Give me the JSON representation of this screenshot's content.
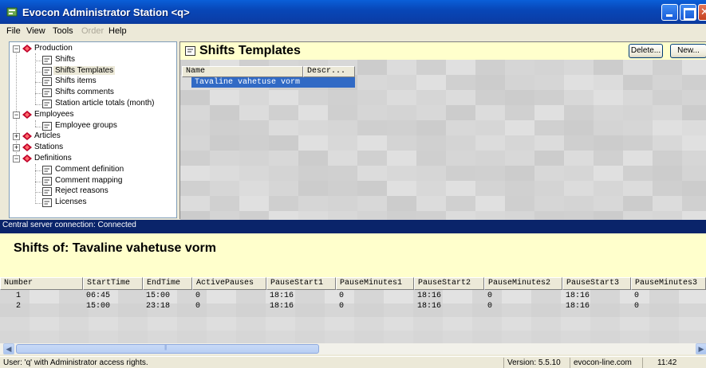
{
  "window": {
    "title": "Evocon Administrator Station  <q>"
  },
  "menu": {
    "items": [
      {
        "label": "File",
        "disabled": false
      },
      {
        "label": "View",
        "disabled": false
      },
      {
        "label": "Tools",
        "disabled": false
      },
      {
        "label": "Order",
        "disabled": true
      },
      {
        "label": "Help",
        "disabled": false
      }
    ]
  },
  "tree": {
    "items": [
      {
        "label": "Production",
        "type": "folder",
        "expander": "−"
      },
      {
        "label": "Shifts",
        "type": "doc"
      },
      {
        "label": "Shifts Templates",
        "type": "doc",
        "selected": true
      },
      {
        "label": "Shifts items",
        "type": "doc"
      },
      {
        "label": "Shifts comments",
        "type": "doc"
      },
      {
        "label": "Station article totals (month)",
        "type": "doc"
      },
      {
        "label": "Employees",
        "type": "folder",
        "expander": "−"
      },
      {
        "label": "Employee groups",
        "type": "doc"
      },
      {
        "label": "Articles",
        "type": "folder",
        "expander": "+"
      },
      {
        "label": "Stations",
        "type": "folder",
        "expander": "+"
      },
      {
        "label": "Definitions",
        "type": "folder",
        "expander": "−"
      },
      {
        "label": "Comment definition",
        "type": "doc"
      },
      {
        "label": "Comment mapping",
        "type": "doc"
      },
      {
        "label": "Reject reasons",
        "type": "doc"
      },
      {
        "label": "Licenses",
        "type": "doc"
      }
    ]
  },
  "templates_panel": {
    "title": "Shifts Templates",
    "delete_label": "Delete...",
    "new_label": "New...",
    "columns": [
      "Name",
      "Descr..."
    ],
    "rows": [
      {
        "name": "Tavaline vahetuse vorm"
      }
    ]
  },
  "connection": {
    "text": "Central server connection:  Connected"
  },
  "shifts_panel": {
    "title": "Shifts of: Tavaline vahetuse vorm",
    "columns": [
      "Number",
      "StartTime",
      "EndTime",
      "ActivePauses",
      "PauseStart1",
      "PauseMinutes1",
      "PauseStart2",
      "PauseMinutes2",
      "PauseStart3",
      "PauseMinutes3"
    ],
    "rows": [
      [
        "1",
        "06:45",
        "15:00",
        "0",
        "18:16",
        "0",
        "18:16",
        "0",
        "18:16",
        "0"
      ],
      [
        "2",
        "15:00",
        "23:18",
        "0",
        "18:16",
        "0",
        "18:16",
        "0",
        "18:16",
        "0"
      ]
    ]
  },
  "status": {
    "user": "User: 'q' with Administrator access rights.",
    "version": "Version: 5.5.10",
    "site": "evocon-line.com",
    "time": "11:42"
  },
  "colors": {
    "titlebar": "#0a5fd8",
    "selection": "#316ac5",
    "header_bg": "#ffffcc",
    "conn_bar": "#0a246a",
    "tree_folder_icon": "#c0002a"
  }
}
